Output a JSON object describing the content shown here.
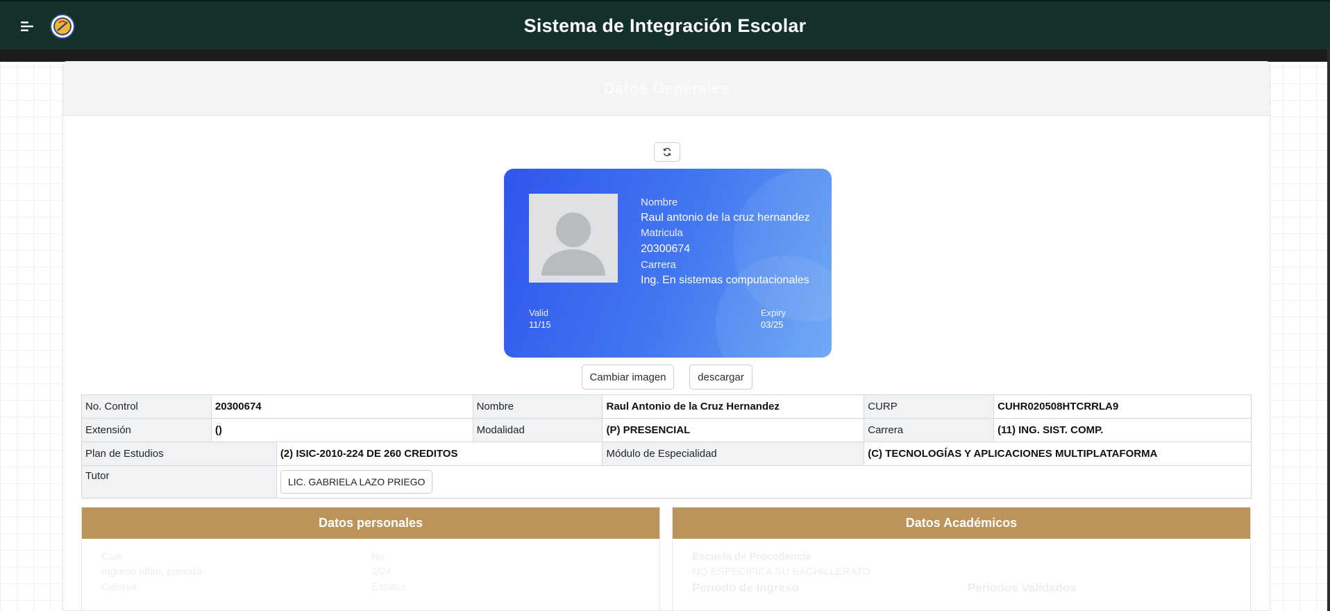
{
  "app": {
    "title": "Sistema de Integración Escolar",
    "menu_icon": "hamburger-menu-icon",
    "logo_icon": "school-logo-icon"
  },
  "card": {
    "title": "Datos Generales"
  },
  "id_card": {
    "nombre_label": "Nombre",
    "nombre_value": "Raul antonio de la cruz hernandez",
    "matricula_label": "Matricula",
    "matricula_value": "20300674",
    "carrera_label": "Carrera",
    "carrera_value": "Ing. En sistemas computacionales",
    "valid_label": "Valid",
    "valid_value": "11/15",
    "expiry_label": "Expiry",
    "expiry_value": "03/25",
    "gradient": [
      "#2f55ec",
      "#66a4f5"
    ]
  },
  "buttons": {
    "refresh_icon": "refresh-icon",
    "change_image": "Cambiar imagen",
    "download": "descargar"
  },
  "info": {
    "control_label": "No. Control",
    "control_value": "20300674",
    "nombre_label": "Nombre",
    "nombre_value": "Raul Antonio de la Cruz Hernandez",
    "curp_label": "CURP",
    "curp_value": "CUHR020508HTCRRLA9",
    "extension_label": "Extensión",
    "extension_value": "()",
    "modalidad_label": "Modalidad",
    "modalidad_value": "(P) PRESENCIAL",
    "carrera_label": "Carrera",
    "carrera_value": "(11) ING. SIST. COMP.",
    "plan_label": "Plan de Estudios",
    "plan_value": "(2) ISIC-2010-224 DE 260 CREDITOS",
    "modulo_label": "Módulo de Especialidad",
    "modulo_value": "(C) TECNOLOGÍAS Y APLICACIONES MULTIPLATAFORMA",
    "tutor_label": "Tutor",
    "tutor_value": "LIC. GABRIELA LAZO PRIEGO"
  },
  "panels": {
    "personal": {
      "title": "Datos personales",
      "faded_rows": [
        "Cuie",
        "No",
        "Ingreso ultim, periodo",
        "2/24",
        "Colonia",
        "Estatus"
      ]
    },
    "academic": {
      "title": "Datos Académicos",
      "faded_rows": [
        "Escuela de Procedencia",
        "NO ESPECIFICA SU BACHILLERATO",
        "Periodo de Ingreso",
        "Periodos Validados"
      ]
    }
  },
  "colors": {
    "topbar": "#13302a",
    "accent_gold": "#bb945b",
    "card_blue": "#2f55ec"
  }
}
